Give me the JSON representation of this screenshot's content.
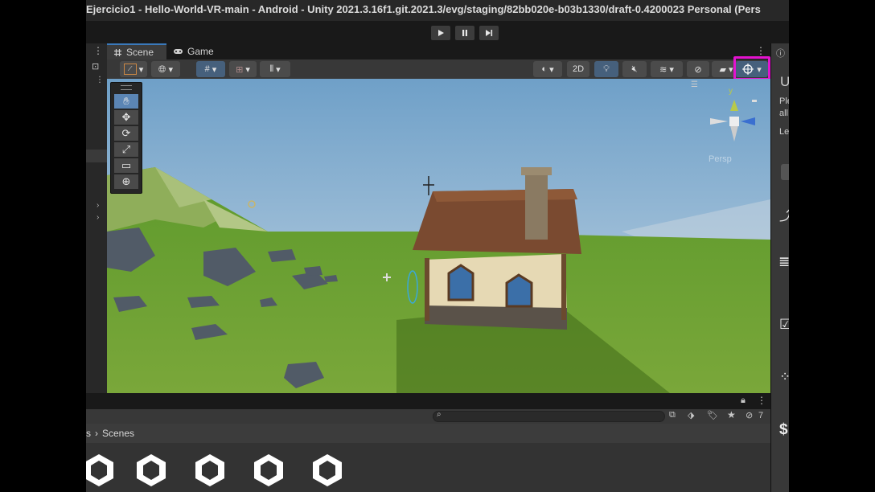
{
  "window": {
    "title": "Ejercicio1 - Hello-World-VR-main - Android - Unity 2021.3.16f1.git.2021.3/evg/staging/82bb020e-b03b1330/draft-0.4200023 Personal (Pers"
  },
  "playbar": {
    "play_icon": "play-icon",
    "pause_icon": "pause-icon",
    "step_icon": "step-icon"
  },
  "tabs": [
    {
      "label": "Scene",
      "icon": "scene-grid-icon"
    },
    {
      "label": "Game",
      "icon": "gamepad-icon"
    }
  ],
  "scene_toolbar": {
    "mode_2d_label": "2D",
    "highlighted_control": "gizmos-toggle"
  },
  "tools": [
    "hand-icon",
    "move-icon",
    "rotate-icon",
    "scale-icon",
    "rect-icon",
    "transform-icon"
  ],
  "orientation_gizmo": {
    "y_label": "y",
    "persp_label": "Persp"
  },
  "inspector": {
    "heading": "U",
    "line1": "Ple",
    "line2": "all",
    "line3": "Le"
  },
  "project": {
    "breadcrumb_root": "s",
    "breadcrumb_folder": "Scenes",
    "hidden_count": "7",
    "asset_icons": [
      "unity-scene-icon",
      "unity-scene-icon",
      "unity-scene-icon",
      "unity-scene-icon",
      "unity-scene-icon"
    ]
  },
  "colors": {
    "highlight": "#e313cf",
    "tab_accent": "#3a79bb",
    "grass": "#6a9a32",
    "sky": "#9ab9d3"
  }
}
